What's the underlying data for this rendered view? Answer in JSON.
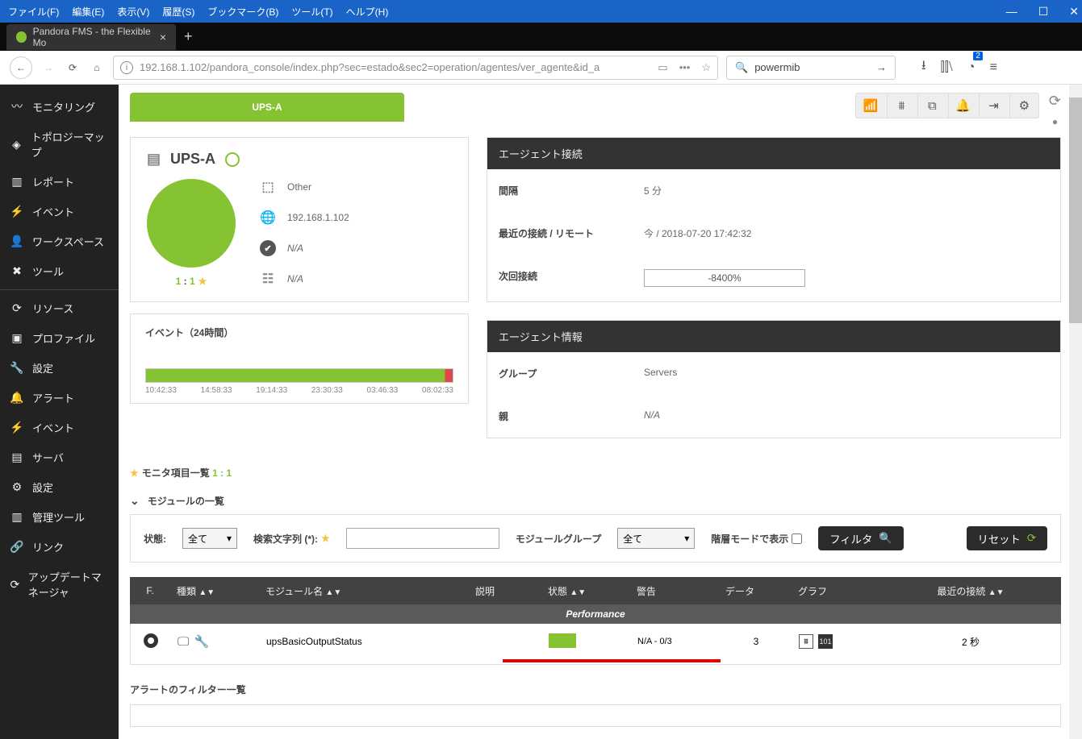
{
  "win_menu": [
    "ファイル(F)",
    "編集(E)",
    "表示(V)",
    "履歴(S)",
    "ブックマーク(B)",
    "ツール(T)",
    "ヘルプ(H)"
  ],
  "tab_title": "Pandora FMS - the Flexible Mo",
  "url": "192.168.1.102/pandora_console/index.php?sec=estado&sec2=operation/agentes/ver_agente&id_a",
  "search_term": "powermib",
  "badge": "2",
  "sidebar": {
    "items": [
      {
        "icon": "〰",
        "label": "モニタリング"
      },
      {
        "icon": "◈",
        "label": "トポロジーマップ"
      },
      {
        "icon": "▥",
        "label": "レポート"
      },
      {
        "icon": "⚡",
        "label": "イベント"
      },
      {
        "icon": "👤",
        "label": "ワークスペース"
      },
      {
        "icon": "✖",
        "label": "ツール"
      }
    ],
    "items2": [
      {
        "icon": "⟳",
        "label": "リソース"
      },
      {
        "icon": "▣",
        "label": "プロファイル"
      },
      {
        "icon": "🔧",
        "label": "設定"
      },
      {
        "icon": "🔔",
        "label": "アラート"
      },
      {
        "icon": "⚡",
        "label": "イベント"
      },
      {
        "icon": "▤",
        "label": "サーバ"
      },
      {
        "icon": "⚙",
        "label": "設定"
      },
      {
        "icon": "▥",
        "label": "管理ツール"
      },
      {
        "icon": "🔗",
        "label": "リンク"
      },
      {
        "icon": "⟳",
        "label": "アップデートマネージャ"
      }
    ]
  },
  "top_tab_label": "UPS-A",
  "agent": {
    "name": "UPS-A",
    "group": "Other",
    "ip": "192.168.1.102",
    "os": "N/A",
    "desc": "N/A",
    "ratio_a": "1",
    "ratio_sep": " : ",
    "ratio_b": "1"
  },
  "contact": {
    "header": "エージェント接続",
    "interval_k": "間隔",
    "interval_v": "5 分",
    "last_k": "最近の接続 / リモート",
    "last_v": "今 / 2018-07-20 17:42:32",
    "next_k": "次回接続",
    "next_v": "-8400%"
  },
  "events_header": "イベント（24時間）",
  "event_times": [
    "10:42:33",
    "14:58:33",
    "19:14:33",
    "23:30:33",
    "03:46:33",
    "08:02:33"
  ],
  "info": {
    "header": "エージェント情報",
    "group_k": "グループ",
    "group_v": "Servers",
    "parent_k": "親",
    "parent_v": "N/A"
  },
  "monitor_title": "モニタ項目一覧",
  "monitor_ratio": "1 : 1",
  "expand_label": "モジュールの一覧",
  "filter": {
    "status_k": "状態:",
    "status_v": "全て",
    "search_k": "検索文字列 (*):",
    "mgroup_k": "モジュールグループ",
    "mgroup_v": "全て",
    "hier_k": "階層モードで表示",
    "btn_filter": "フィルタ",
    "btn_reset": "リセット"
  },
  "table": {
    "cols": {
      "f": "F.",
      "type": "種類",
      "mod": "モジュール名",
      "desc": "説明",
      "stat": "状態",
      "warn": "警告",
      "data": "データ",
      "graph": "グラフ",
      "last": "最近の接続"
    },
    "group_label": "Performance",
    "row": {
      "module": "upsBasicOutputStatus",
      "warn": "N/A - 0/3",
      "data": "3",
      "last": "2 秒",
      "g2": "101"
    }
  },
  "alerts_title": "アラートのフィルター一覧"
}
